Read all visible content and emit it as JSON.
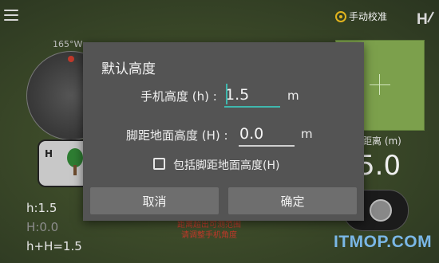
{
  "app": {
    "calibrate_label": "手动校准",
    "compass_label": "165°W",
    "readouts": [
      "h:1.5",
      "H:0.0",
      "h+H=1.5"
    ],
    "warning": [
      "距离超出可测范围",
      "请调整手机角度"
    ],
    "distance_label": "距离 (m)",
    "distance_value": "5.0",
    "watermark": "ITMOP.COM"
  },
  "dialog": {
    "title": "默认高度",
    "phone_height": {
      "label": "手机高度 (h) :",
      "value": "1.5",
      "unit": "m"
    },
    "ground_height": {
      "label": "脚距地面高度 (H) :",
      "value": "0.0",
      "unit": "m"
    },
    "include_checkbox": {
      "label": "包括脚距地面高度(H)",
      "checked": false
    },
    "cancel_label": "取消",
    "ok_label": "确定"
  },
  "colors": {
    "accent": "#3fb8ae",
    "underline": "#d0d0d0",
    "dialog_bg": "#545454",
    "button_bg": "#6e6e6e"
  }
}
